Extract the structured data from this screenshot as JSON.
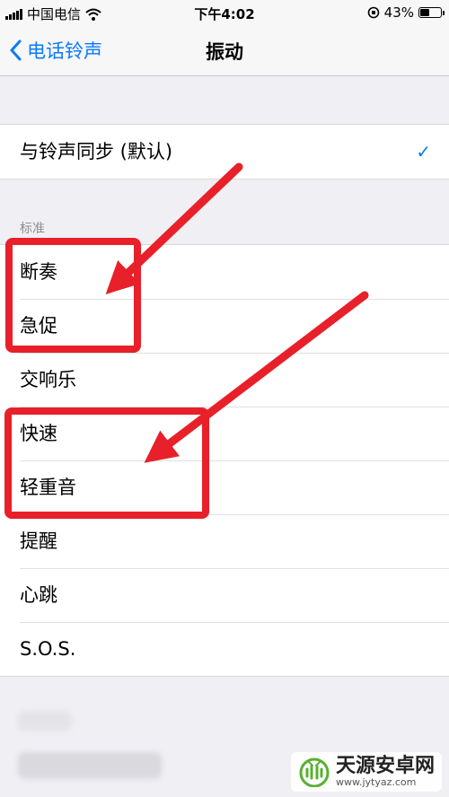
{
  "status_bar": {
    "carrier": "中国电信",
    "time": "下午4:02",
    "battery": "43%",
    "battery_level": 0.43
  },
  "nav": {
    "back_label": "电话铃声",
    "title": "振动"
  },
  "sync_option": {
    "label": "与铃声同步 (默认)",
    "selected": true
  },
  "standard_section": {
    "header": "标准",
    "items": [
      "断奏",
      "急促",
      "交响乐",
      "快速",
      "轻重音",
      "提醒",
      "心跳",
      "S.O.S."
    ]
  },
  "annotations": {
    "highlight_color": "#e8202a"
  },
  "watermark": {
    "name": "天源安卓网",
    "url": "www.jytyaz.com"
  },
  "colors": {
    "accent": "#0a7aff",
    "background": "#efeff4"
  }
}
